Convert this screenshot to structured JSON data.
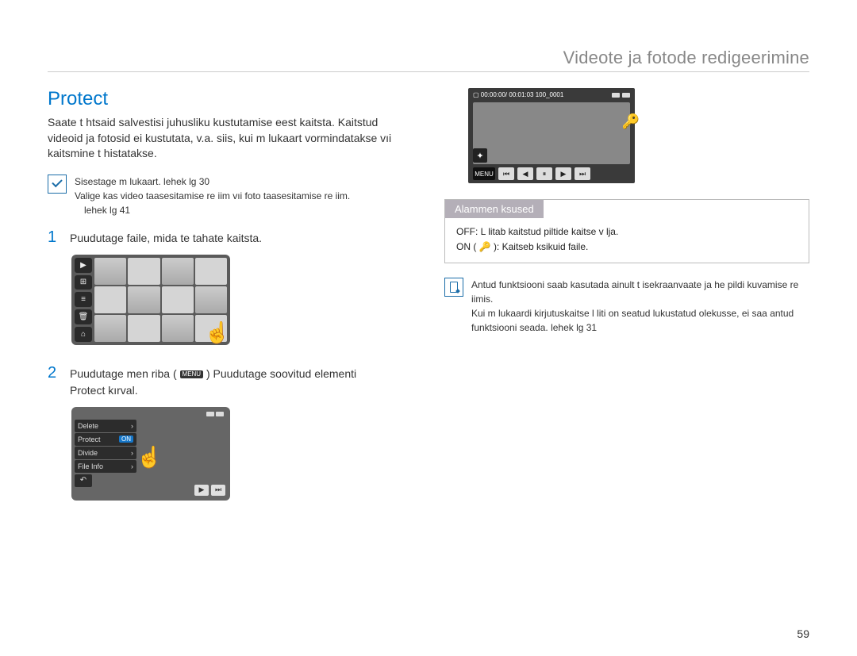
{
  "header": {
    "title": "Videote ja fotode redigeerimine"
  },
  "section": {
    "title": "Protect"
  },
  "intro": "Saate t htsaid salvestisi juhusliku kustutamise eest kaitsta. Kaitstud videoid ja fotosid ei kustutata, v.a. siis, kui m lukaart vormindatakse vıi kaitsmine t histatakse.",
  "prereq": {
    "line1": "Sisestage m lukaart.   lehek lg 30",
    "line2": "Valige kas video taasesitamise re iim vıi foto taasesitamise re iim.",
    "line2ref": "lehek lg 41"
  },
  "steps": {
    "s1": {
      "num": "1",
      "text": "Puudutage faile, mida te tahate kaitsta."
    },
    "s2": {
      "num": "2",
      "pre": "Puudutage men  riba ( ",
      "menu": "MENU",
      "mid": " )    Puudutage soovitud elementi",
      "post": "Protect   kırval."
    }
  },
  "menu_items": {
    "delete": "Delete",
    "protect": "Protect",
    "divide": "Divide",
    "fileinfo": "File Info",
    "on": "ON"
  },
  "play_top": {
    "left": "▢ 00:00:00/ 00:01:03   100_0001"
  },
  "submenu": {
    "heading": "Alammen    ksused",
    "off": "OFF: L litab kaitstud piltide kaitse v lja.",
    "on": "ON ( 🔑 ): Kaitseb  ksikuid faile."
  },
  "note2": {
    "l1": "Antud funktsiooni saab kasutada ainult t isekraanvaate ja  he pildi kuvamise re iimis.",
    "l2": "Kui m lukaardi kirjutuskaitse l liti on seatud lukustatud olekusse, ei saa antud funktsiooni seada.   lehek lg 31"
  },
  "pagenum": "59"
}
